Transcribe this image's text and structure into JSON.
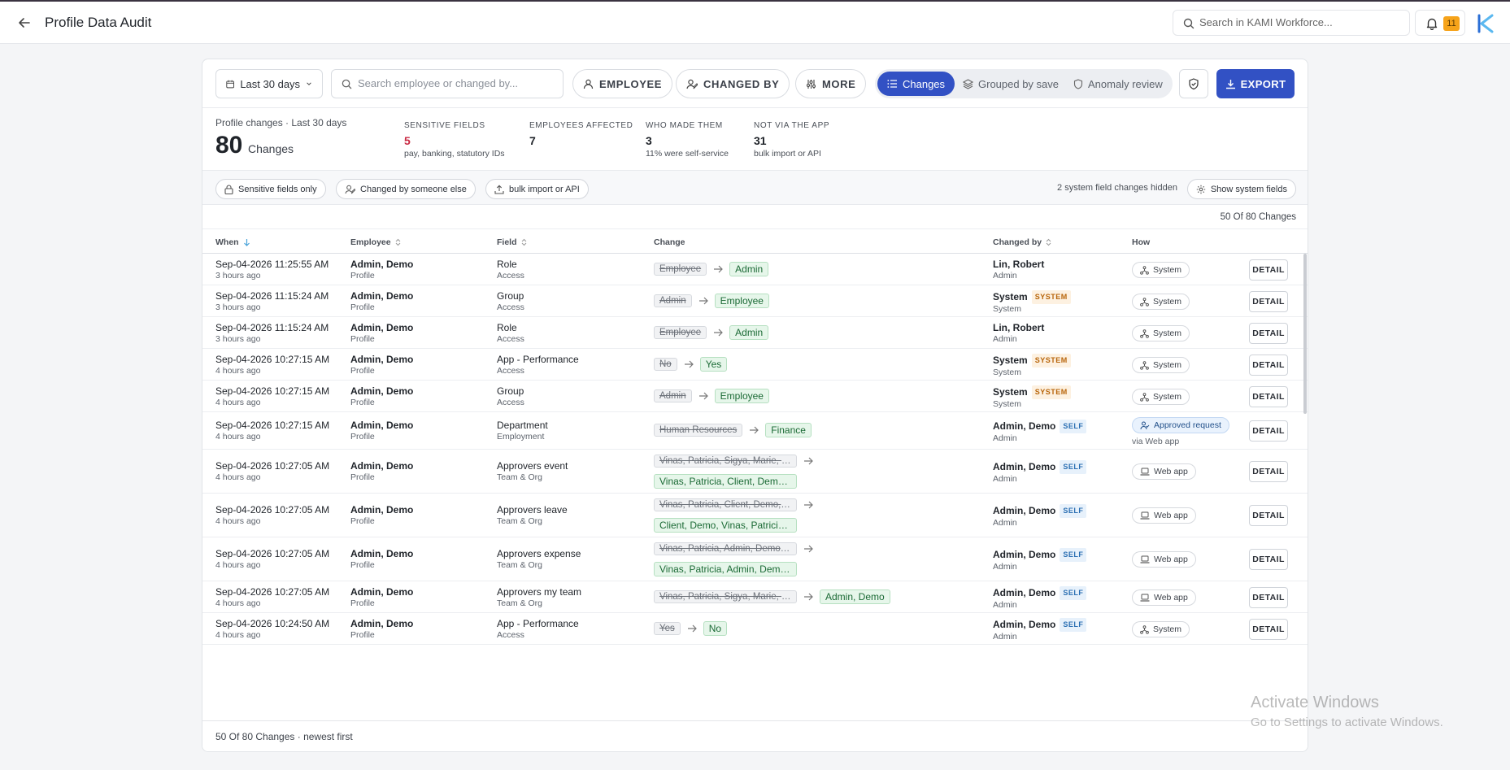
{
  "header": {
    "title": "Profile Data Audit",
    "search_placeholder": "Search in KAMI Workforce...",
    "notification_count": "11"
  },
  "toolbar": {
    "date_range": "Last 30 days",
    "search_placeholder": "Search employee or changed by...",
    "employee_label": "EMPLOYEE",
    "changed_by_label": "CHANGED BY",
    "more_label": "MORE",
    "views": [
      "Changes",
      "Grouped by save",
      "Anomaly review"
    ],
    "export_label": "EXPORT"
  },
  "summary": {
    "label": "Profile changes · Last 30 days",
    "total": "80",
    "total_unit": "Changes",
    "stats": [
      {
        "heading": "SENSITIVE FIELDS",
        "value": "5",
        "sub": "pay, banking, statutory IDs"
      },
      {
        "heading": "EMPLOYEES AFFECTED",
        "value": "7",
        "sub": ""
      },
      {
        "heading": "WHO MADE THEM",
        "value": "3",
        "sub": "11% were self-service"
      },
      {
        "heading": "NOT VIA THE APP",
        "value": "31",
        "sub": "bulk import or API"
      }
    ]
  },
  "filters": {
    "chips": [
      "Sensitive fields only",
      "Changed by someone else",
      "bulk import or API"
    ],
    "hidden_note": "2 system field changes hidden",
    "show_system": "Show system fields"
  },
  "count_label": "50 Of 80 Changes",
  "table": {
    "columns": [
      "When",
      "Employee",
      "Field",
      "Change",
      "Changed by",
      "How"
    ],
    "detail_label": "DETAIL",
    "rows": [
      {
        "when": "Sep-04-2026 11:25:55 AM",
        "ago": "3 hours ago",
        "employee": "Admin, Demo",
        "emp_sub": "Profile",
        "field": "Role",
        "field_sub": "Access",
        "old": "Employee",
        "new": "Admin",
        "by": "Lin, Robert",
        "by_sub": "Admin",
        "tag": "",
        "how": "System"
      },
      {
        "when": "Sep-04-2026 11:15:24 AM",
        "ago": "3 hours ago",
        "employee": "Admin, Demo",
        "emp_sub": "Profile",
        "field": "Group",
        "field_sub": "Access",
        "old": "Admin",
        "new": "Employee",
        "by": "System",
        "by_sub": "System",
        "tag": "SYSTEM",
        "how": "System"
      },
      {
        "when": "Sep-04-2026 11:15:24 AM",
        "ago": "3 hours ago",
        "employee": "Admin, Demo",
        "emp_sub": "Profile",
        "field": "Role",
        "field_sub": "Access",
        "old": "Employee",
        "new": "Admin",
        "by": "Lin, Robert",
        "by_sub": "Admin",
        "tag": "",
        "how": "System"
      },
      {
        "when": "Sep-04-2026 10:27:15 AM",
        "ago": "4 hours ago",
        "employee": "Admin, Demo",
        "emp_sub": "Profile",
        "field": "App - Performance",
        "field_sub": "Access",
        "old": "No",
        "new": "Yes",
        "by": "System",
        "by_sub": "System",
        "tag": "SYSTEM",
        "how": "System"
      },
      {
        "when": "Sep-04-2026 10:27:15 AM",
        "ago": "4 hours ago",
        "employee": "Admin, Demo",
        "emp_sub": "Profile",
        "field": "Group",
        "field_sub": "Access",
        "old": "Admin",
        "new": "Employee",
        "by": "System",
        "by_sub": "System",
        "tag": "SYSTEM",
        "how": "System"
      },
      {
        "when": "Sep-04-2026 10:27:15 AM",
        "ago": "4 hours ago",
        "employee": "Admin, Demo",
        "emp_sub": "Profile",
        "field": "Department",
        "field_sub": "Employment",
        "old": "Human Resources",
        "new": "Finance",
        "by": "Admin, Demo",
        "by_sub": "Admin",
        "tag": "SELF",
        "how": "Approved request",
        "how_sub": "via Web app"
      },
      {
        "when": "Sep-04-2026 10:27:05 AM",
        "ago": "4 hours ago",
        "employee": "Admin, Demo",
        "emp_sub": "Profile",
        "field": "Approvers event",
        "field_sub": "Team & Org",
        "old": "Vinas, Patricia, Sigya, Marie, Clien...",
        "new": "Vinas, Patricia, Client, Demo, Sig...",
        "by": "Admin, Demo",
        "by_sub": "Admin",
        "tag": "SELF",
        "how": "Web app"
      },
      {
        "when": "Sep-04-2026 10:27:05 AM",
        "ago": "4 hours ago",
        "employee": "Admin, Demo",
        "emp_sub": "Profile",
        "field": "Approvers leave",
        "field_sub": "Team & Org",
        "old": "Vinas, Patricia, Client, Demo, Sigy...",
        "new": "Client, Demo, Vinas, Patricia, Sig...",
        "by": "Admin, Demo",
        "by_sub": "Admin",
        "tag": "SELF",
        "how": "Web app"
      },
      {
        "when": "Sep-04-2026 10:27:05 AM",
        "ago": "4 hours ago",
        "employee": "Admin, Demo",
        "emp_sub": "Profile",
        "field": "Approvers expense",
        "field_sub": "Team & Org",
        "old": "Vinas, Patricia, Admin, Demo, Sig...",
        "new": "Vinas, Patricia, Admin, Demo, Sig...",
        "by": "Admin, Demo",
        "by_sub": "Admin",
        "tag": "SELF",
        "how": "Web app"
      },
      {
        "when": "Sep-04-2026 10:27:05 AM",
        "ago": "4 hours ago",
        "employee": "Admin, Demo",
        "emp_sub": "Profile",
        "field": "Approvers my team",
        "field_sub": "Team & Org",
        "old": "Vinas, Patricia, Sigya, Marie, Clien...",
        "new": "Admin, Demo",
        "by": "Admin, Demo",
        "by_sub": "Admin",
        "tag": "SELF",
        "how": "Web app"
      },
      {
        "when": "Sep-04-2026 10:24:50 AM",
        "ago": "4 hours ago",
        "employee": "Admin, Demo",
        "emp_sub": "Profile",
        "field": "App - Performance",
        "field_sub": "Access",
        "old": "Yes",
        "new": "No",
        "by": "Admin, Demo",
        "by_sub": "Admin",
        "tag": "SELF",
        "how": "System"
      }
    ]
  },
  "footer": "50 Of 80 Changes · newest first",
  "watermark": {
    "line1": "Activate Windows",
    "line2": "Go to Settings to activate Windows."
  },
  "colors": {
    "accent": "#3251c4",
    "sensitive": "#c92a43",
    "notification": "#f6a31a"
  }
}
